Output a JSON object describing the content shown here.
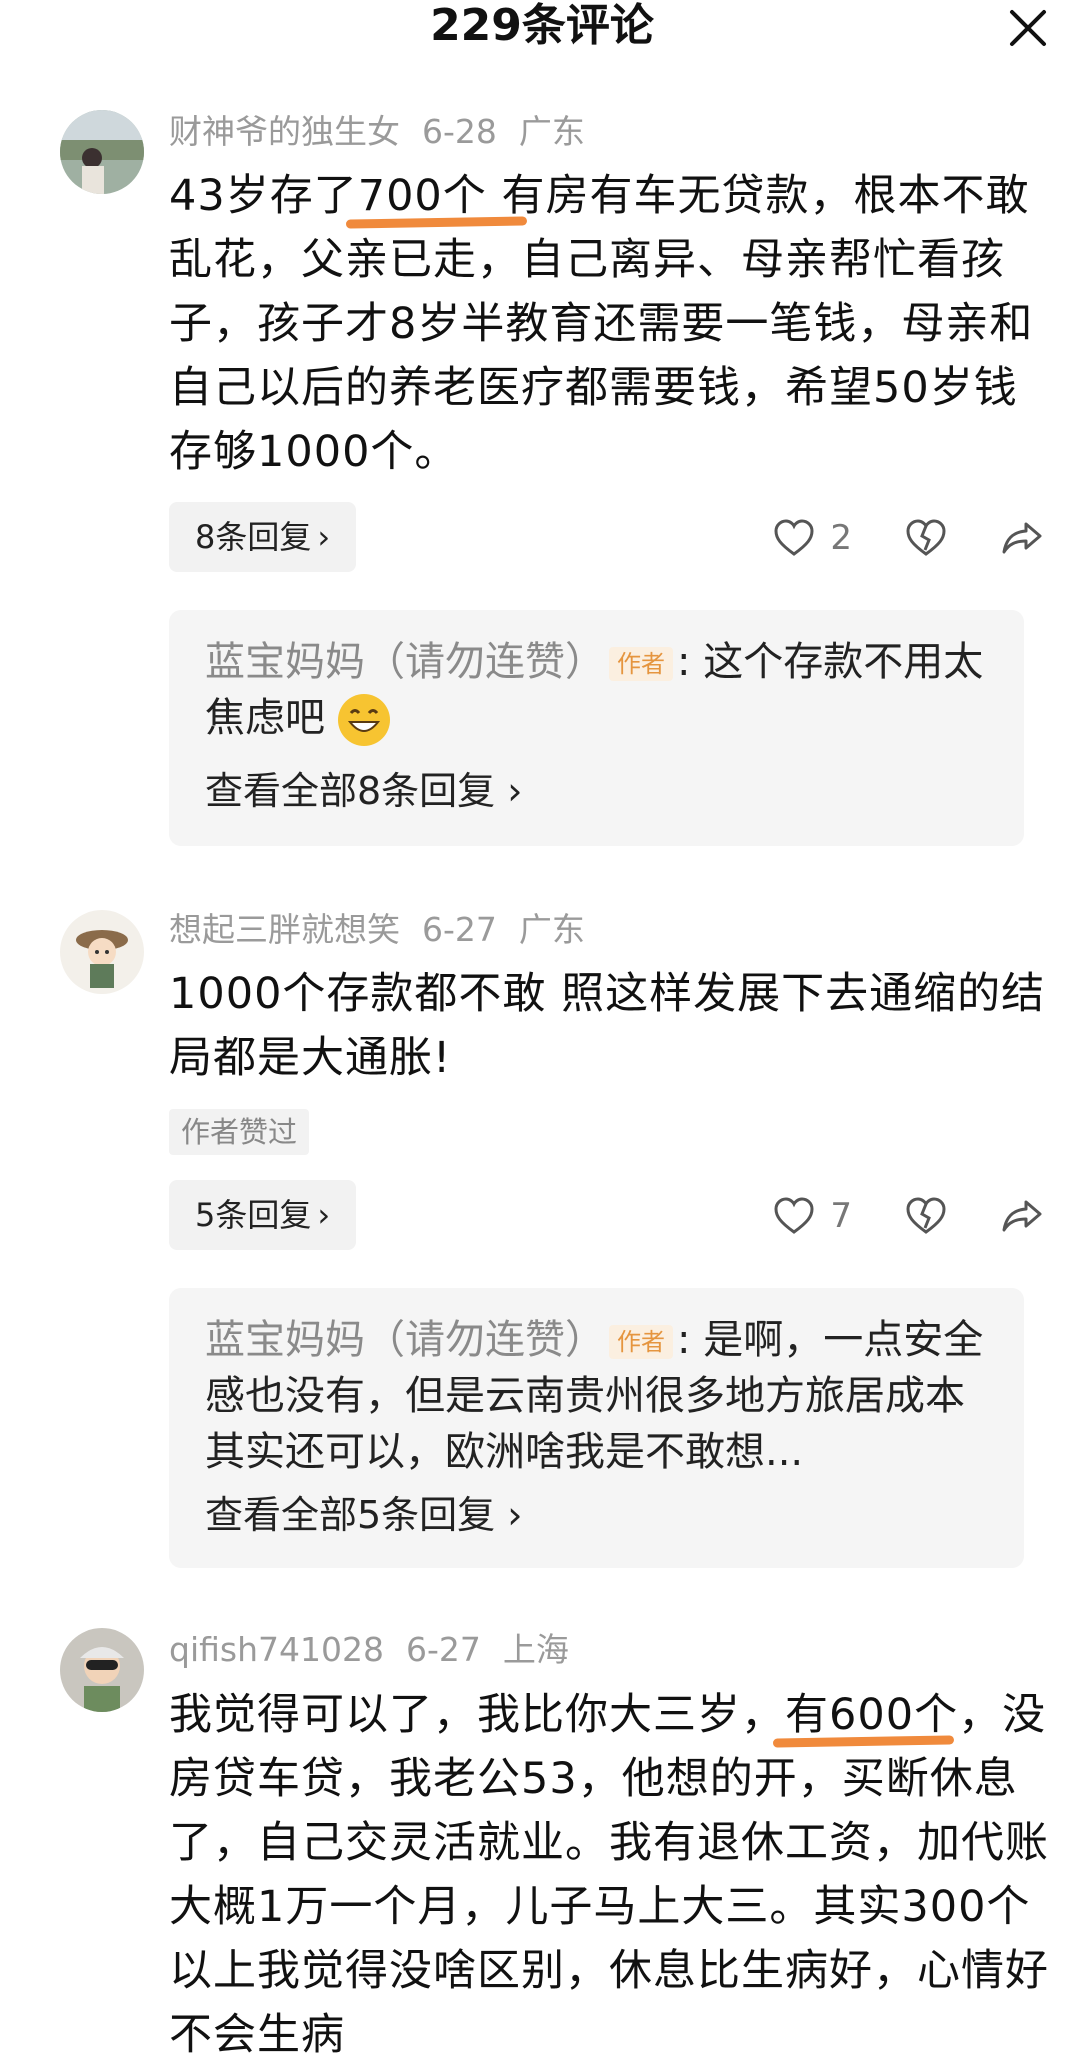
{
  "header": {
    "title": "229条评论"
  },
  "comments": [
    {
      "user": "财神爷的独生女",
      "date": "6-28",
      "location": "广东",
      "text_pre": "43岁存了",
      "text_hl": "700个",
      "text_post": " 有房有车无贷款，根本不敢乱花，父亲已走，自己离异、母亲帮忙看孩子，孩子才8岁半教育还需要一笔钱，母亲和自己以后的养老医疗都需要钱，希望50岁钱存够1000个。",
      "reply_label": "8条回复",
      "like_count": "2",
      "sub": {
        "user": "蓝宝妈妈（请勿连赞）",
        "tag": "作者",
        "text": ": 这个存款不用太焦虑吧",
        "view_all": "查看全部8条回复"
      }
    },
    {
      "user": "想起三胖就想笑",
      "date": "6-27",
      "location": "广东",
      "text": "1000个存款都不敢 照这样发展下去通缩的结局都是大通胀!",
      "liked_badge": "作者赞过",
      "reply_label": "5条回复",
      "like_count": "7",
      "sub": {
        "user": "蓝宝妈妈（请勿连赞）",
        "tag": "作者",
        "text": ": 是啊，一点安全感也没有，但是云南贵州很多地方旅居成本其实还可以，欧洲啥我是不敢想...",
        "view_all": "查看全部5条回复"
      }
    },
    {
      "user": "qifish741028",
      "date": "6-27",
      "location": "上海",
      "text_pre": "我觉得可以了，我比你大三岁，",
      "text_hl": "有600",
      "text_post": "个，没房贷车贷，我老公53，他想的开，买断休息了，自己交灵活就业。我有退休工资，加代账大概1万一个月，儿子马上大三。其实300个以上我觉得没啥区别，休息比生病好，心情好不会生病"
    }
  ]
}
